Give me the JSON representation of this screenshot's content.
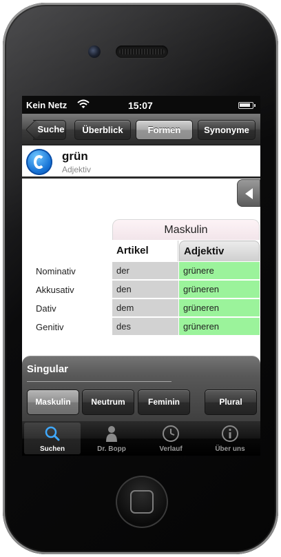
{
  "status": {
    "carrier": "Kein Netz",
    "time": "15:07"
  },
  "nav": {
    "back_label": "Suche",
    "tabs": [
      "Überblick",
      "Formen",
      "Synonyme"
    ],
    "selected_tab": "Formen"
  },
  "word": {
    "title": "grün",
    "type": "Adjektiv"
  },
  "table": {
    "gender": "Maskulin",
    "col_artikel": "Artikel",
    "col_adjektiv": "Adjektiv",
    "rows": [
      {
        "case": "Nominativ",
        "artikel": "der",
        "adjektiv": "grünere"
      },
      {
        "case": "Akkusativ",
        "artikel": "den",
        "adjektiv": "grüneren"
      },
      {
        "case": "Dativ",
        "artikel": "dem",
        "adjektiv": "grüneren"
      },
      {
        "case": "Genitiv",
        "artikel": "des",
        "adjektiv": "grüneren"
      }
    ],
    "adjektiv_color": "#9bf39b",
    "artikel_color": "#d2d2d2"
  },
  "panel": {
    "title": "Singular",
    "buttons": [
      "Maskulin",
      "Neutrum",
      "Feminin",
      "Plural"
    ],
    "selected": "Maskulin"
  },
  "tabbar": {
    "items": [
      {
        "label": "Suchen",
        "icon": "search-icon"
      },
      {
        "label": "Dr. Bopp",
        "icon": "person-icon"
      },
      {
        "label": "Verlauf",
        "icon": "clock-icon"
      },
      {
        "label": "Über uns",
        "icon": "info-icon"
      }
    ],
    "selected": "Suchen"
  }
}
